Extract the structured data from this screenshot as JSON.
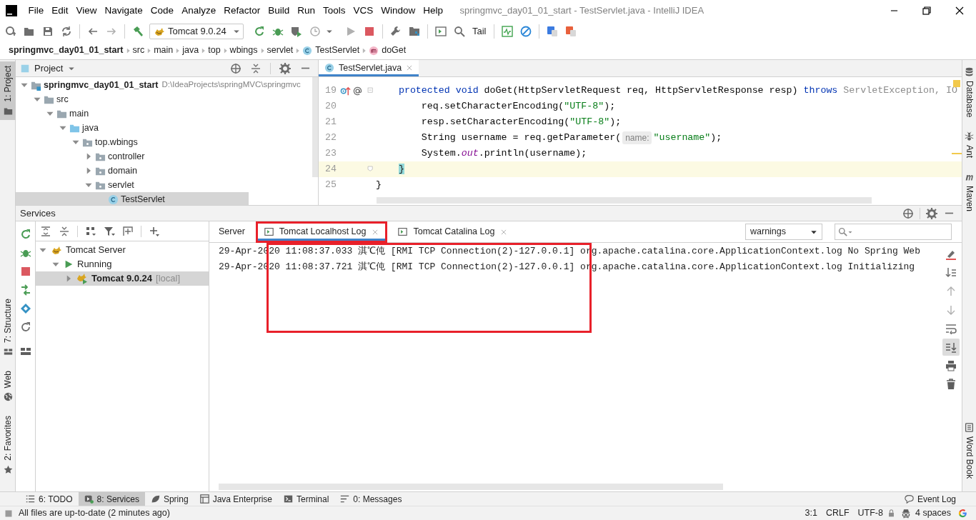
{
  "window": {
    "title": "springmvc_day01_01_start - TestServlet.java - IntelliJ IDEA"
  },
  "menu": [
    "File",
    "Edit",
    "View",
    "Navigate",
    "Code",
    "Analyze",
    "Refactor",
    "Build",
    "Run",
    "Tools",
    "VCS",
    "Window",
    "Help"
  ],
  "toolbar": {
    "run_config": "Tomcat 9.0.24",
    "tail": "Tail"
  },
  "breadcrumbs": [
    {
      "label": "springmvc_day01_01_start",
      "kind": "project"
    },
    {
      "label": "src",
      "kind": "dir"
    },
    {
      "label": "main",
      "kind": "dir"
    },
    {
      "label": "java",
      "kind": "dir"
    },
    {
      "label": "top",
      "kind": "dir"
    },
    {
      "label": "wbings",
      "kind": "dir"
    },
    {
      "label": "servlet",
      "kind": "dir"
    },
    {
      "label": "TestServlet",
      "kind": "class"
    },
    {
      "label": "doGet",
      "kind": "method"
    }
  ],
  "left_tool_tabs": {
    "top": [
      {
        "label": "1: Project",
        "kind": "project",
        "selected": true
      }
    ],
    "bottom": [
      {
        "label": "7: Structure",
        "kind": "structure",
        "selected": false
      },
      {
        "label": "Web",
        "kind": "web",
        "selected": false
      },
      {
        "label": "2: Favorites",
        "kind": "favorites",
        "selected": false
      }
    ]
  },
  "right_tool_tabs": {
    "top": [
      {
        "label": "Database",
        "kind": "database"
      },
      {
        "label": "Ant",
        "kind": "ant"
      },
      {
        "label": "Maven",
        "kind": "maven"
      }
    ],
    "bottom": [
      {
        "label": "Word Book",
        "kind": "book"
      }
    ]
  },
  "project_panel": {
    "title": "Project",
    "tree": [
      {
        "label": "springmvc_day01_01_start",
        "path": "D:\\IdeaProjects\\springMVC\\springmvc",
        "kind": "module",
        "expanded": true,
        "selected": false,
        "children": [
          {
            "label": "src",
            "kind": "folder",
            "expanded": true,
            "selected": false,
            "children": [
              {
                "label": "main",
                "kind": "folder",
                "expanded": true,
                "selected": false,
                "children": [
                  {
                    "label": "java",
                    "kind": "source",
                    "expanded": true,
                    "selected": false,
                    "children": [
                      {
                        "label": "top.wbings",
                        "kind": "package",
                        "expanded": true,
                        "selected": false,
                        "children": [
                          {
                            "label": "controller",
                            "kind": "package",
                            "expanded": false,
                            "selected": false
                          },
                          {
                            "label": "domain",
                            "kind": "package",
                            "expanded": false,
                            "selected": false
                          },
                          {
                            "label": "servlet",
                            "kind": "package",
                            "expanded": true,
                            "selected": false,
                            "children": [
                              {
                                "label": "TestServlet",
                                "kind": "class",
                                "selected": true
                              }
                            ]
                          }
                        ]
                      }
                    ]
                  }
                ]
              }
            ]
          }
        ]
      }
    ]
  },
  "editor": {
    "tabs": [
      {
        "label": "TestServlet.java",
        "selected": true
      }
    ],
    "lines": [
      {
        "number": "19",
        "current": false,
        "override": true,
        "tokens": [
          {
            "text": "    protected void ",
            "kind": "keyword"
          },
          {
            "text": "doGet(HttpServletRequest req, HttpServletResponse resp) ",
            "kind": "plain"
          },
          {
            "text": "throws ",
            "kind": "keyword"
          },
          {
            "text": "ServletException, IO",
            "kind": "muted"
          }
        ]
      },
      {
        "number": "20",
        "current": false,
        "tokens": [
          {
            "text": "        req.setCharacterEncoding(",
            "kind": "plain"
          },
          {
            "text": "\"UTF-8\"",
            "kind": "string"
          },
          {
            "text": ");",
            "kind": "plain"
          }
        ]
      },
      {
        "number": "21",
        "current": false,
        "tokens": [
          {
            "text": "        resp.setCharacterEncoding(",
            "kind": "plain"
          },
          {
            "text": "\"UTF-8\"",
            "kind": "string"
          },
          {
            "text": ");",
            "kind": "plain"
          }
        ]
      },
      {
        "number": "22",
        "current": false,
        "tokens": [
          {
            "text": "        String username = req.getParameter(",
            "kind": "plain"
          },
          {
            "text": "name:",
            "kind": "hint"
          },
          {
            "text": "\"username\"",
            "kind": "string"
          },
          {
            "text": ");",
            "kind": "plain"
          }
        ]
      },
      {
        "number": "23",
        "current": false,
        "tokens": [
          {
            "text": "        System.",
            "kind": "plain"
          },
          {
            "text": "out",
            "kind": "field"
          },
          {
            "text": ".println(username);",
            "kind": "plain"
          }
        ]
      },
      {
        "number": "24",
        "current": true,
        "tokens": [
          {
            "text": "    }",
            "kind": "brace_match"
          }
        ]
      },
      {
        "number": "25",
        "current": false,
        "tokens": [
          {
            "text": "}",
            "kind": "plain"
          }
        ]
      }
    ]
  },
  "services": {
    "title": "Services",
    "tree": [
      {
        "label": "Tomcat Server",
        "kind": "server",
        "expanded": true,
        "selected": false,
        "children": [
          {
            "label": "Running",
            "kind": "running",
            "expanded": true,
            "selected": false,
            "children": [
              {
                "label": "Tomcat 9.0.24",
                "note": "[local]",
                "kind": "tomcat",
                "expanded": false,
                "selected": true
              }
            ]
          }
        ]
      }
    ],
    "log_tabs": [
      {
        "label": "Server",
        "closable": false,
        "selected": false,
        "highlighted": false
      },
      {
        "label": "Tomcat Localhost Log",
        "closable": true,
        "selected": true,
        "highlighted": true
      },
      {
        "label": "Tomcat Catalina Log",
        "closable": true,
        "selected": false,
        "highlighted": false
      }
    ],
    "filter": "warnings",
    "log_lines": [
      "29-Apr-2020 11:08:37.033 淇℃伅 [RMI TCP Connection(2)-127.0.0.1] org.apache.catalina.core.ApplicationContext.log No Spring Web",
      "29-Apr-2020 11:08:37.721 淇℃伅 [RMI TCP Connection(2)-127.0.0.1] org.apache.catalina.core.ApplicationContext.log Initializing"
    ],
    "log_highlight_box": true
  },
  "bottom_tabs": [
    {
      "label": "6: TODO",
      "kind": "todo",
      "selected": false
    },
    {
      "label": "8: Services",
      "kind": "services",
      "selected": true
    },
    {
      "label": "Spring",
      "kind": "spring",
      "selected": false
    },
    {
      "label": "Java Enterprise",
      "kind": "enterprise",
      "selected": false
    },
    {
      "label": "Terminal",
      "kind": "terminal",
      "selected": false
    },
    {
      "label": "0: Messages",
      "kind": "messages",
      "selected": false
    }
  ],
  "event_log": "Event Log",
  "status_bar": {
    "message": "All files are up-to-date (2 minutes ago)",
    "items": [
      "3:1",
      "CRLF",
      "UTF-8",
      "4 spaces"
    ]
  }
}
